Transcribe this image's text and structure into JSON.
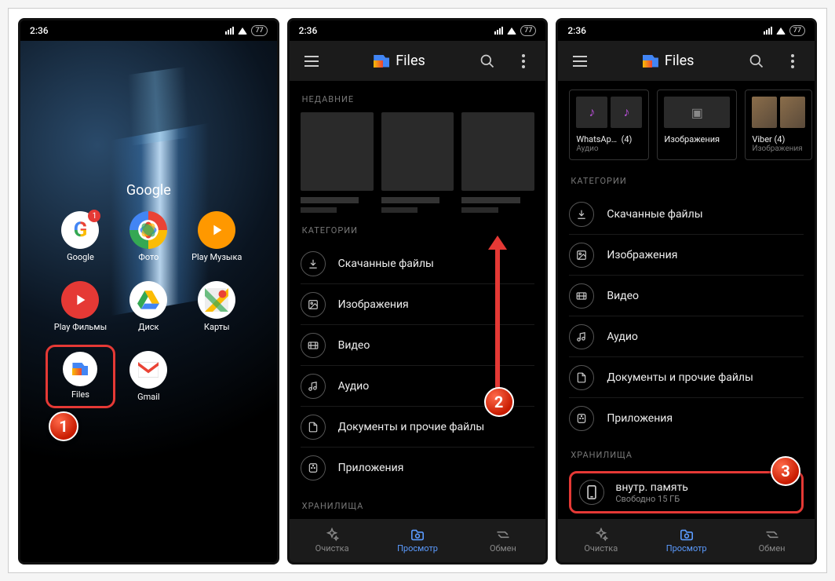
{
  "statusbar": {
    "time": "2:36",
    "battery": "77"
  },
  "screen1": {
    "folder_title": "Google",
    "apps": [
      {
        "label": "Google",
        "icon": "google",
        "badge": "1"
      },
      {
        "label": "Фото",
        "icon": "photos"
      },
      {
        "label": "Play Музыка",
        "icon": "play-music"
      },
      {
        "label": "Play Фильмы",
        "icon": "play-films"
      },
      {
        "label": "Диск",
        "icon": "drive"
      },
      {
        "label": "Карты",
        "icon": "maps"
      },
      {
        "label": "Files",
        "icon": "files",
        "highlight": true
      },
      {
        "label": "Gmail",
        "icon": "gmail"
      }
    ]
  },
  "toolbar": {
    "title": "Files"
  },
  "sections": {
    "recent": "НЕДАВНИЕ",
    "categories": "КАТЕГОРИИ",
    "storage": "ХРАНИЛИЩА"
  },
  "categories": [
    {
      "label": "Скачанные файлы",
      "icon": "download"
    },
    {
      "label": "Изображения",
      "icon": "image"
    },
    {
      "label": "Видео",
      "icon": "video"
    },
    {
      "label": "Аудио",
      "icon": "audio"
    },
    {
      "label": "Документы и прочие файлы",
      "icon": "document"
    },
    {
      "label": "Приложения",
      "icon": "apps"
    }
  ],
  "top_cards": [
    {
      "title": "WhatsAp…",
      "count": "(4)",
      "sub": "Аудио",
      "type": "audio"
    },
    {
      "title": "Изображения",
      "count": "",
      "sub": "",
      "type": "image"
    },
    {
      "title": "Viber",
      "count": "(4)",
      "sub": "Изображения",
      "type": "photo"
    }
  ],
  "storage": {
    "title": "внутр. память",
    "subtitle": "Свободно 15 ГБ"
  },
  "bottomnav": {
    "clean": "Очистка",
    "browse": "Просмотр",
    "share": "Обмен"
  },
  "steps": {
    "s1": "1",
    "s2": "2",
    "s3": "3"
  }
}
